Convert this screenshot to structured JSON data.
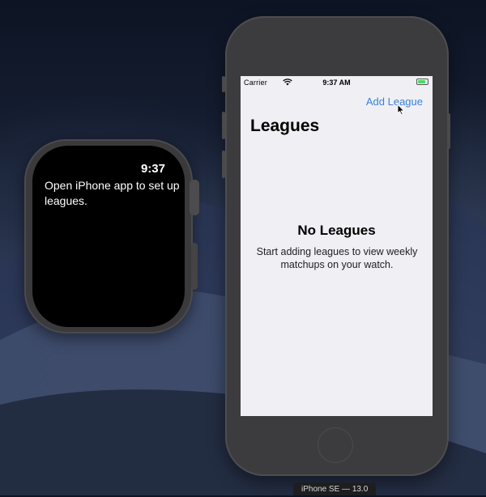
{
  "watch": {
    "time": "9:37",
    "message": "Open iPhone app to set up leagues."
  },
  "phone": {
    "status_bar": {
      "carrier": "Carrier",
      "time": "9:37 AM",
      "battery_icon": "battery-icon",
      "wifi_icon": "wifi-icon"
    },
    "nav": {
      "add_league_label": "Add League",
      "title": "Leagues"
    },
    "empty_state": {
      "title": "No Leagues",
      "message": "Start adding leagues to view weekly matchups on your watch."
    }
  },
  "device_label": "iPhone SE — 13.0",
  "colors": {
    "accent": "#3b82d6",
    "phone_screen_bg": "#efeff4",
    "watch_screen_bg": "#000000",
    "device_frame": "#3c3c3e"
  }
}
